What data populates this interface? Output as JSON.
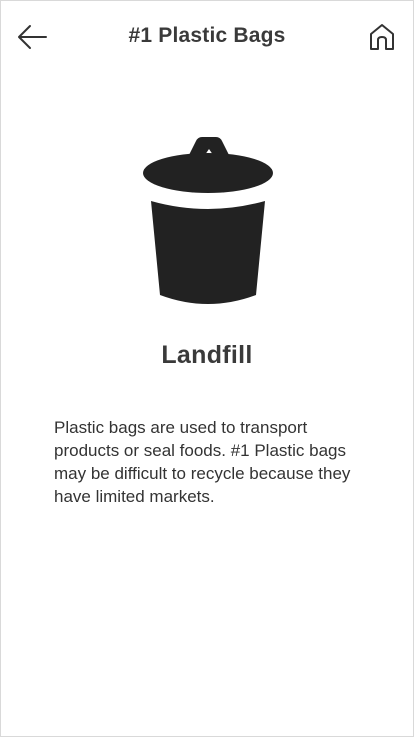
{
  "header": {
    "title": "#1 Plastic Bags",
    "back_icon": "arrow-left-icon",
    "home_icon": "home-icon"
  },
  "main": {
    "icon": "trash-bin-icon",
    "category": "Landfill",
    "description": "Plastic bags are used to transport products or seal foods. #1 Plastic bags may be difficult to recycle because they have limited markets."
  },
  "colors": {
    "icon": "#222222",
    "text": "#333333",
    "background": "#ffffff"
  }
}
